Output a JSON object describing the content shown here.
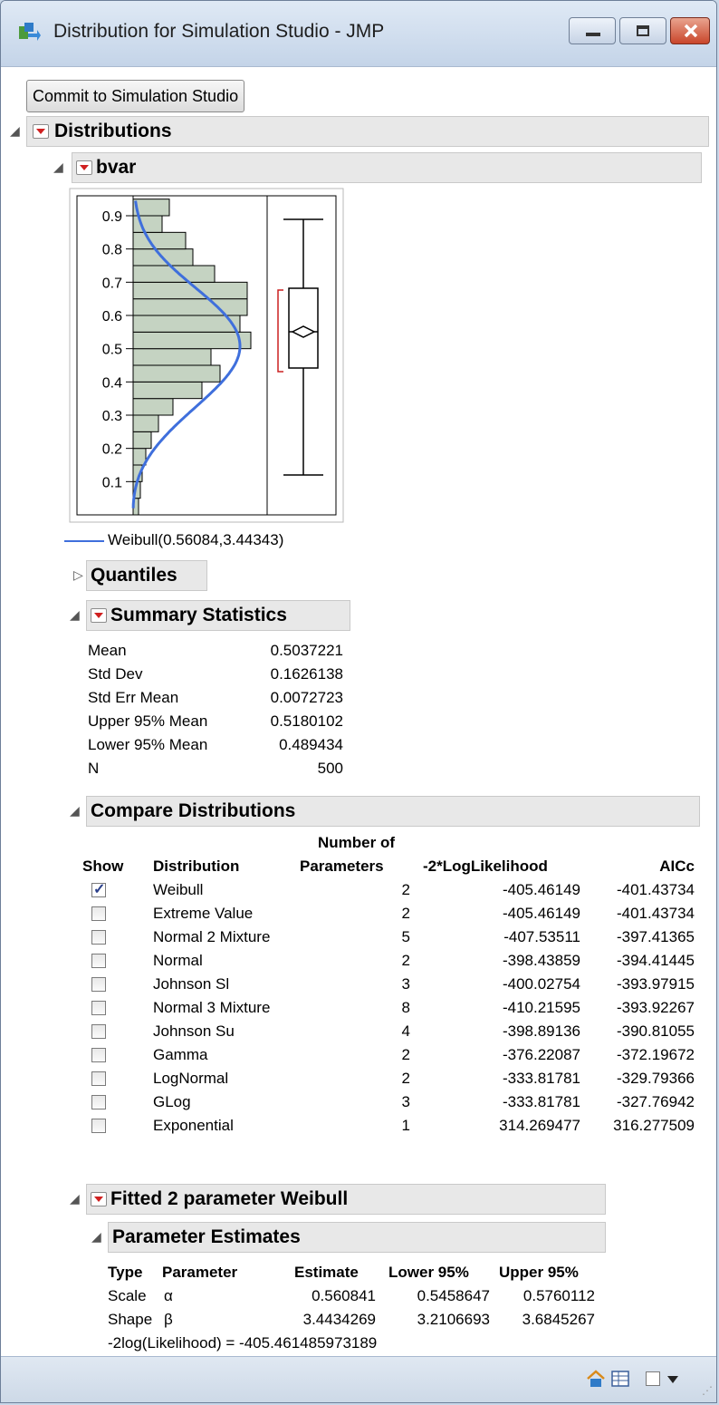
{
  "window": {
    "title": "Distribution for Simulation Studio - JMP"
  },
  "commit_button": "Commit to Simulation Studio",
  "distributions_header": "Distributions",
  "variable_header": "bvar",
  "histogram": {
    "y_ticks": [
      "0.9",
      "0.8",
      "0.7",
      "0.6",
      "0.5",
      "0.4",
      "0.3",
      "0.2",
      "0.1"
    ],
    "colors": {
      "bar_fill": "#c5d3c2",
      "curve": "#3f6fdc",
      "confidence_bracket": "#cc2020"
    }
  },
  "legend_label": "Weibull(0.56084,3.44343)",
  "quantiles_header": "Quantiles",
  "summary": {
    "header": "Summary Statistics",
    "rows": [
      {
        "label": "Mean",
        "value": "0.5037221"
      },
      {
        "label": "Std Dev",
        "value": "0.1626138"
      },
      {
        "label": "Std Err Mean",
        "value": "0.0072723"
      },
      {
        "label": "Upper 95% Mean",
        "value": "0.5180102"
      },
      {
        "label": "Lower 95% Mean",
        "value": "0.489434"
      },
      {
        "label": "N",
        "value": "500"
      }
    ]
  },
  "compare": {
    "header": "Compare Distributions",
    "col_params_top": "Number of",
    "col_show": "Show",
    "col_distribution": "Distribution",
    "col_params": "Parameters",
    "col_loglik": "-2*LogLikelihood",
    "col_aicc": "AICc",
    "rows": [
      {
        "show": true,
        "name": "Weibull",
        "params": "2",
        "loglik": "-405.46149",
        "aicc": "-401.43734"
      },
      {
        "show": false,
        "name": "Extreme Value",
        "params": "2",
        "loglik": "-405.46149",
        "aicc": "-401.43734"
      },
      {
        "show": false,
        "name": "Normal 2 Mixture",
        "params": "5",
        "loglik": "-407.53511",
        "aicc": "-397.41365"
      },
      {
        "show": false,
        "name": "Normal",
        "params": "2",
        "loglik": "-398.43859",
        "aicc": "-394.41445"
      },
      {
        "show": false,
        "name": "Johnson Sl",
        "params": "3",
        "loglik": "-400.02754",
        "aicc": "-393.97915"
      },
      {
        "show": false,
        "name": "Normal 3 Mixture",
        "params": "8",
        "loglik": "-410.21595",
        "aicc": "-393.92267"
      },
      {
        "show": false,
        "name": "Johnson Su",
        "params": "4",
        "loglik": "-398.89136",
        "aicc": "-390.81055"
      },
      {
        "show": false,
        "name": "Gamma",
        "params": "2",
        "loglik": "-376.22087",
        "aicc": "-372.19672"
      },
      {
        "show": false,
        "name": "LogNormal",
        "params": "2",
        "loglik": "-333.81781",
        "aicc": "-329.79366"
      },
      {
        "show": false,
        "name": "GLog",
        "params": "3",
        "loglik": "-333.81781",
        "aicc": "-327.76942"
      },
      {
        "show": false,
        "name": "Exponential",
        "params": "1",
        "loglik": "314.269477",
        "aicc": "316.277509"
      }
    ]
  },
  "fitted": {
    "header": "Fitted 2 parameter Weibull",
    "estimates_header": "Parameter Estimates",
    "cols": [
      "Type",
      "Parameter",
      "Estimate",
      "Lower 95%",
      "Upper 95%"
    ],
    "rows": [
      {
        "type": "Scale",
        "param": "α",
        "estimate": "0.560841",
        "lower": "0.5458647",
        "upper": "0.5760112"
      },
      {
        "type": "Shape",
        "param": "β",
        "estimate": "3.4434269",
        "lower": "3.2106693",
        "upper": "3.6845267"
      }
    ],
    "loglik_line": "-2log(Likelihood) = -405.461485973189"
  }
}
